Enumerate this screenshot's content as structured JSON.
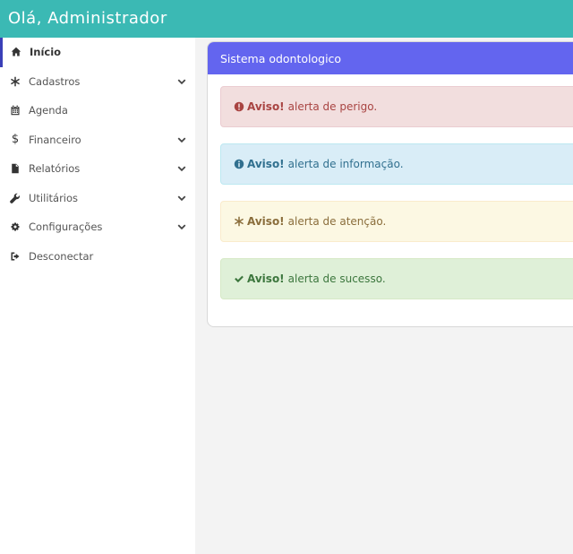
{
  "header": {
    "title": "Olá, Administrador"
  },
  "sidebar": {
    "items": [
      {
        "label": "Início",
        "icon": "home-icon",
        "active": true,
        "has_submenu": false
      },
      {
        "label": "Cadastros",
        "icon": "asterisk-icon",
        "active": false,
        "has_submenu": true
      },
      {
        "label": "Agenda",
        "icon": "calendar-icon",
        "active": false,
        "has_submenu": false
      },
      {
        "label": "Financeiro",
        "icon": "dollar-icon",
        "active": false,
        "has_submenu": true
      },
      {
        "label": "Relatórios",
        "icon": "file-icon",
        "active": false,
        "has_submenu": true
      },
      {
        "label": "Utilitários",
        "icon": "wrench-icon",
        "active": false,
        "has_submenu": true
      },
      {
        "label": "Configurações",
        "icon": "gear-icon",
        "active": false,
        "has_submenu": true
      },
      {
        "label": "Desconectar",
        "icon": "sign-out-icon",
        "active": false,
        "has_submenu": false
      }
    ]
  },
  "main": {
    "card_title": "Sistema odontologico",
    "alerts": [
      {
        "type": "danger",
        "icon": "exclamation-circle-icon",
        "strong": "Aviso!",
        "text": "alerta de perigo."
      },
      {
        "type": "info",
        "icon": "info-circle-icon",
        "strong": "Aviso!",
        "text": "alerta de informação."
      },
      {
        "type": "warning",
        "icon": "asterisk-icon",
        "strong": "Aviso!",
        "text": "alerta de atenção."
      },
      {
        "type": "success",
        "icon": "check-icon",
        "strong": "Aviso!",
        "text": "alerta de sucesso."
      }
    ]
  },
  "colors": {
    "topbar": "#3bb9b4",
    "card_header": "#6365ef",
    "active_indicator": "#3a3fb8"
  }
}
